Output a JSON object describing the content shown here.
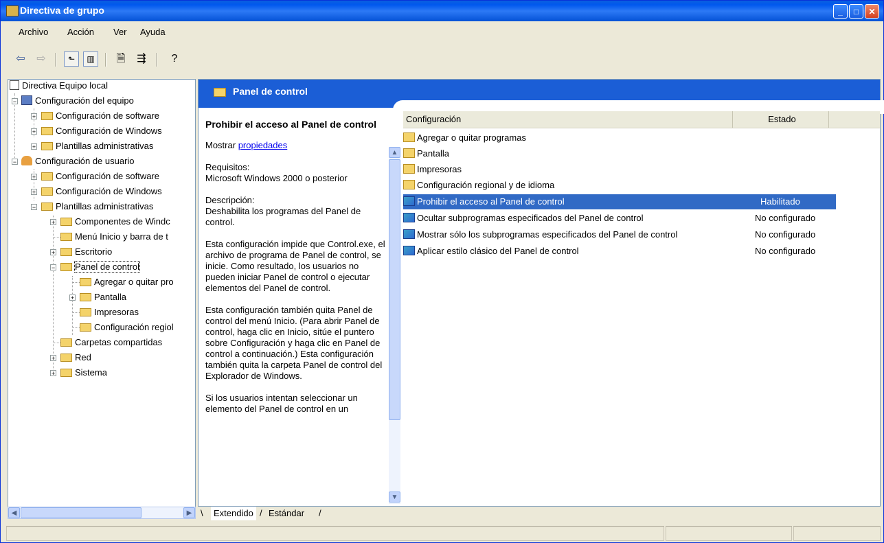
{
  "window": {
    "title": "Directiva de grupo",
    "buttons": [
      "minimize-icon",
      "maximize-icon",
      "close-icon"
    ]
  },
  "menu": [
    "Archivo",
    "Acción",
    "Ver",
    "Ayuda"
  ],
  "toolbar": [
    "back-arrow-icon",
    "forward-arrow-icon",
    "up-folder-icon",
    "show-hide-tree-icon",
    "properties-icon",
    "export-list-icon",
    "help-icon"
  ],
  "tree": {
    "root": "Directiva Equipo local",
    "items": [
      "Configuración del equipo",
      "Configuración de software",
      "Configuración de Windows",
      "Plantillas administrativas",
      "Configuración de usuario",
      "Configuración de software",
      "Configuración de Windows",
      "Plantillas administrativas",
      "Componentes de Windc",
      "Menú Inicio y barra de t",
      "Escritorio",
      "Panel de control",
      "Agregar o quitar pro",
      "Pantalla",
      "Impresoras",
      "Configuración regiol",
      "Carpetas compartidas",
      "Red",
      "Sistema"
    ]
  },
  "pane": {
    "header": "Panel de control",
    "desc": {
      "title": "Prohibir el acceso al Panel de control",
      "show": "Mostrar",
      "show_link": "propiedades",
      "req_label": "Requisitos:",
      "req_text": "Microsoft Windows 2000 o posterior",
      "desc_label": "Descripción:",
      "desc_text": "Deshabilita los programas del Panel de control.",
      "p1": "Esta configuración impide que Control.exe, el archivo de programa de Panel de control, se inicie. Como resultado, los usuarios no pueden iniciar Panel de control o ejecutar elementos del Panel de control.",
      "p2": "Esta configuración también quita Panel de control del menú Inicio. (Para abrir Panel de control, haga clic en Inicio, sitúe el puntero sobre Configuración y haga clic en Panel de control a continuación.) Esta configuración también quita la carpeta Panel de control del Explorador de Windows.",
      "p3": "Si los usuarios intentan seleccionar un elemento del Panel de control en un"
    },
    "columns": {
      "config": "Configuración",
      "state": "Estado"
    },
    "rows": [
      {
        "name": "Agregar o quitar programas",
        "state": "",
        "type": "folder"
      },
      {
        "name": "Pantalla",
        "state": "",
        "type": "folder"
      },
      {
        "name": "Impresoras",
        "state": "",
        "type": "folder"
      },
      {
        "name": "Configuración regional y de idioma",
        "state": "",
        "type": "folder"
      },
      {
        "name": "Prohibir el acceso al Panel de control",
        "state": "Habilitado",
        "type": "policy"
      },
      {
        "name": "Ocultar subprogramas especificados del Panel de control",
        "state": "No configurado",
        "type": "policy"
      },
      {
        "name": "Mostrar sólo los subprogramas especificados del Panel de control",
        "state": "No configurado",
        "type": "policy"
      },
      {
        "name": "Aplicar estilo clásico del Panel de control",
        "state": "No configurado",
        "type": "policy"
      }
    ]
  },
  "tabs": [
    "Extendido",
    "Estándar"
  ],
  "colors": {
    "titlebar": "#0058ee",
    "header": "#1b5ed6",
    "selection": "#316ac5",
    "folder": "#f4d36a"
  }
}
